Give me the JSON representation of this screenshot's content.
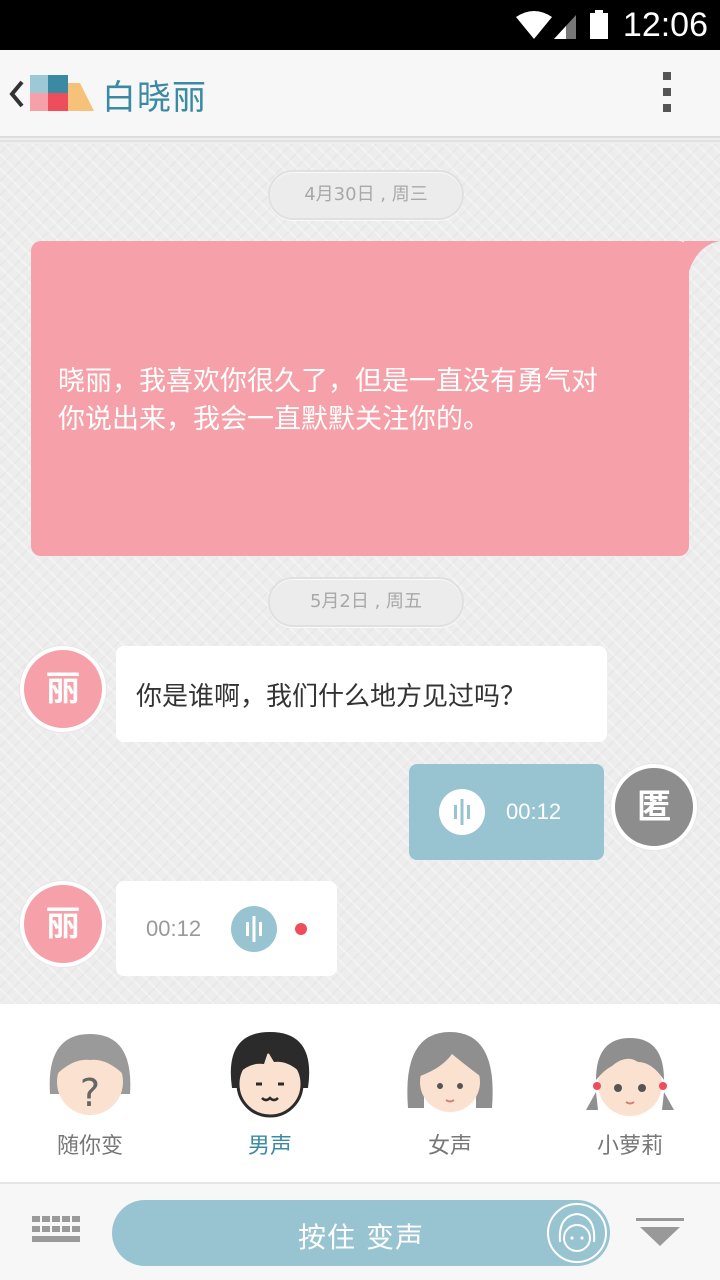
{
  "status_bar": {
    "time": "12:06"
  },
  "header": {
    "contact_name": "白晓丽"
  },
  "chat": {
    "date_1": "4月30日 , 周三",
    "big_message": "晓丽，我喜欢你很久了，但是一直没有勇气对你说出来，我会一直默默关注你的。",
    "date_2": "5月2日 , 周五",
    "reply_avatar": "丽",
    "reply_text": "你是谁啊，我们什么地方见过吗？",
    "my_avatar": "匿",
    "my_voice_duration": "00:12",
    "their_avatar": "丽",
    "their_voice_duration": "00:12"
  },
  "voice_options": [
    {
      "label": "随你变",
      "icon": "mystery-face-icon",
      "active": false
    },
    {
      "label": "男声",
      "icon": "male-face-icon",
      "active": true
    },
    {
      "label": "女声",
      "icon": "female-face-icon",
      "active": false
    },
    {
      "label": "小萝莉",
      "icon": "little-girl-face-icon",
      "active": false
    }
  ],
  "bottom_bar": {
    "hold_label": "按住 变声"
  },
  "colors": {
    "accent_blue": "#98c4d1",
    "title_blue": "#3b8aa3",
    "pink": "#f6a1a9",
    "unread": "#ee4d5b"
  }
}
